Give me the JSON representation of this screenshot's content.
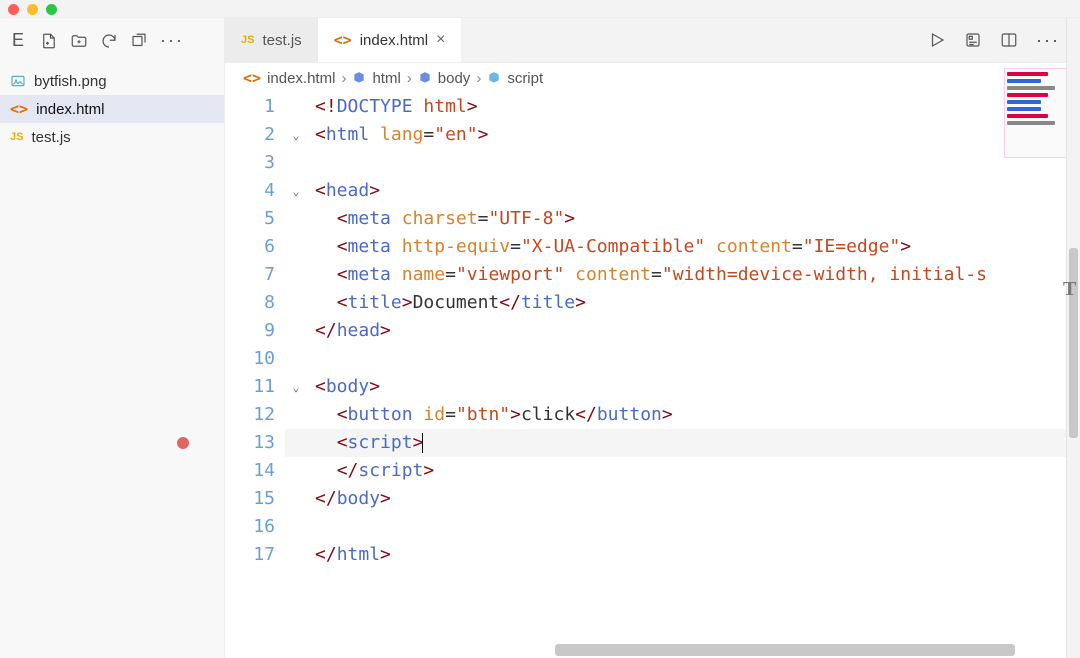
{
  "window": {
    "e_label": "E"
  },
  "sidebar": {
    "files": [
      {
        "name": "bytfish.png",
        "type": "image"
      },
      {
        "name": "index.html",
        "type": "html",
        "active": true
      },
      {
        "name": "test.js",
        "type": "js"
      }
    ]
  },
  "tabs": [
    {
      "label": "test.js",
      "type": "js",
      "active": false
    },
    {
      "label": "index.html",
      "type": "html",
      "active": true
    }
  ],
  "breadcrumb": [
    {
      "label": "index.html",
      "icon": "html"
    },
    {
      "label": "html",
      "icon": "cube"
    },
    {
      "label": "body",
      "icon": "cube"
    },
    {
      "label": "script",
      "icon": "cube2"
    }
  ],
  "editor": {
    "line_count": 17,
    "current_line": 13,
    "breakpoint_line": 13,
    "lines": {
      "1": "<!DOCTYPE html>",
      "2": "<html lang=\"en\">",
      "3": "",
      "4": "<head>",
      "5": "  <meta charset=\"UTF-8\">",
      "6": "  <meta http-equiv=\"X-UA-Compatible\" content=\"IE=edge\">",
      "7": "  <meta name=\"viewport\" content=\"width=device-width, initial-s",
      "8": "  <title>Document</title>",
      "9": "</head>",
      "10": "",
      "11": "<body>",
      "12": "  <button id=\"btn\">click</button>",
      "13": "  <script>",
      "14": "  </script>",
      "15": "</body>",
      "16": "",
      "17": "</html>"
    }
  },
  "labels": {
    "js_prefix": "JS",
    "html_glyph": "<>",
    "close_glyph": "×",
    "dots": "···",
    "chevron": "›"
  }
}
